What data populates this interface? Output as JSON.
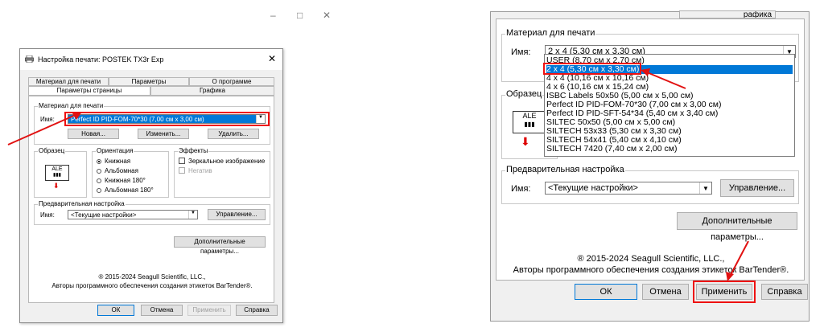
{
  "window_controls": {
    "minimize": "–",
    "maximize": "□",
    "close": "✕"
  },
  "left_dialog": {
    "title": "Настройка печати: POSTEK TX3r Exp",
    "close": "✕",
    "tabs_row1": [
      "Материал для печати",
      "Параметры",
      "О программе"
    ],
    "tabs_row2": [
      "Параметры страницы",
      "Графика"
    ],
    "material_group": "Материал для печати",
    "name_label": "Имя:",
    "material_value": "Perfect ID PID-FOM-70*30 (7,00 см x 3,00 см)",
    "buttons": {
      "new": "Новая...",
      "edit": "Изменить...",
      "delete": "Удалить..."
    },
    "sample_group": "Образец",
    "sample_icon_text": "ALE",
    "orientation_group": "Ориентация",
    "orientation_options": [
      "Книжная",
      "Альбомная",
      "Книжная 180°",
      "Альбомная 180°"
    ],
    "effects_group": "Эффекты",
    "effects_options": [
      "Зеркальное изображение",
      "Негатив"
    ],
    "preset_group": "Предварительная настройка",
    "preset_label": "Имя:",
    "preset_value": "<Текущие настройки>",
    "manage_button": "Управление...",
    "advanced_button": "Дополнительные параметры...",
    "copyright": "® 2015-2024 Seagull Scientific, LLC.,",
    "authors": "Авторы программного обеспечения создания этикеток BarTender®.",
    "footer": {
      "ok": "ОК",
      "cancel": "Отмена",
      "apply": "Применить",
      "help": "Справка"
    }
  },
  "right_panel": {
    "tab_fragment": "рафика",
    "material_group": "Материал для печати",
    "name_label": "Имя:",
    "material_value": "2 x 4 (5,30 см x 3,30 см)",
    "dropdown_items": [
      "USER (8,70 см x 2,70 см)",
      "2 x 4 (5,30 см x 3,30 см)",
      "4 x 4 (10,16 см x 10,16 см)",
      "4 x 6 (10,16 см x 15,24 см)",
      "ISBC Labels 50x50 (5,00 см x 5,00 см)",
      "Perfect ID PID-FOM-70*30 (7,00 см x 3,00 см)",
      "Perfect ID PID-SFT-54*34 (5,40 см x 3,40 см)",
      "SILTEC 50x50 (5,00 см x 5,00 см)",
      "SILTECH 53x33 (5,30 см x 3,30 см)",
      "SILTECH 54x41 (5,40 см x 4,10 см)",
      "SILTECH 7420 (7,40 см x 2,00 см)"
    ],
    "sample_group": "Образец",
    "sample_icon_text": "ALE",
    "preset_group": "Предварительная настройка",
    "preset_label": "Имя:",
    "preset_value": "<Текущие настройки>",
    "manage_button": "Управление...",
    "advanced_button": "Дополнительные параметры...",
    "copyright": "® 2015-2024 Seagull Scientific, LLC.,",
    "authors": "Авторы программного обеспечения создания этикеток BarTender®.",
    "footer": {
      "ok": "ОК",
      "cancel": "Отмена",
      "apply": "Применить",
      "help": "Справка"
    }
  },
  "colors": {
    "highlight": "#0078d7",
    "annotation": "#e11111",
    "dialog_bg": "#f0f0f0"
  }
}
